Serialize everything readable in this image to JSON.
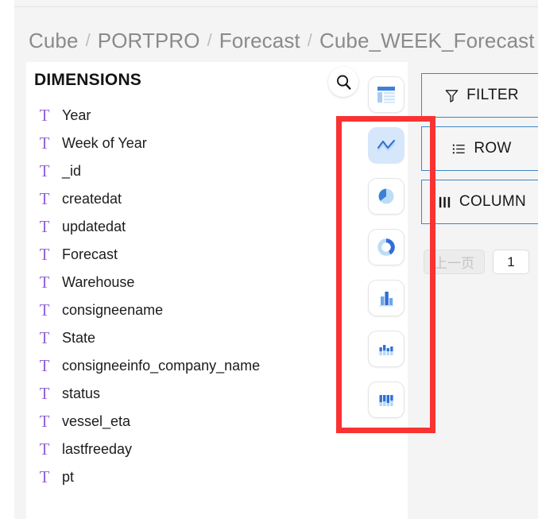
{
  "breadcrumb": {
    "separator": "/",
    "items": [
      "Cube",
      "PORTPRO",
      "Forecast",
      "Cube_WEEK_Forecast"
    ]
  },
  "dimensions_panel": {
    "title": "DIMENSIONS",
    "field_type_icon": "text-type-icon",
    "field_type_glyph": "T",
    "items": [
      "Year",
      "Week of Year",
      "_id",
      "createdat",
      "updatedat",
      "Forecast",
      "Warehouse",
      "consigneename",
      "State",
      "consigneeinfo_company_name",
      "status",
      "vessel_eta",
      "lastfreeday",
      "pt"
    ]
  },
  "toolbar": {
    "search_icon": "search-icon",
    "chart_types": [
      {
        "name": "table-chart-icon",
        "selected": false
      },
      {
        "name": "line-chart-icon",
        "selected": true
      },
      {
        "name": "pie-chart-icon",
        "selected": false
      },
      {
        "name": "donut-chart-icon",
        "selected": false
      },
      {
        "name": "bar-chart-icon",
        "selected": false
      },
      {
        "name": "grouped-bar-chart-icon",
        "selected": false
      },
      {
        "name": "stacked-bar-chart-icon",
        "selected": false
      }
    ]
  },
  "controls": {
    "rows": [
      {
        "label": "FILTER",
        "icon": "filter-funnel-icon",
        "chip_color": "#7b6ce8"
      },
      {
        "label": "ROW",
        "icon": "list-rows-icon",
        "chip_color": "#3489db"
      },
      {
        "label": "COLUMN",
        "icon": "columns-icon",
        "chip_color": "#4fbcef"
      }
    ]
  },
  "pagination": {
    "prev_label": "上一页",
    "page_value": "1"
  },
  "annotation": {
    "highlight_color": "#fa3232",
    "target": "chart-type-rail"
  },
  "colors": {
    "page_background": "#f4f4f4",
    "card_background": "#ffffff",
    "breadcrumb_text": "#8a8a8a",
    "dimension_icon": "#9463d6",
    "control_border": "#3d86c6",
    "selected_chart_bg": "#d6e7fb"
  }
}
